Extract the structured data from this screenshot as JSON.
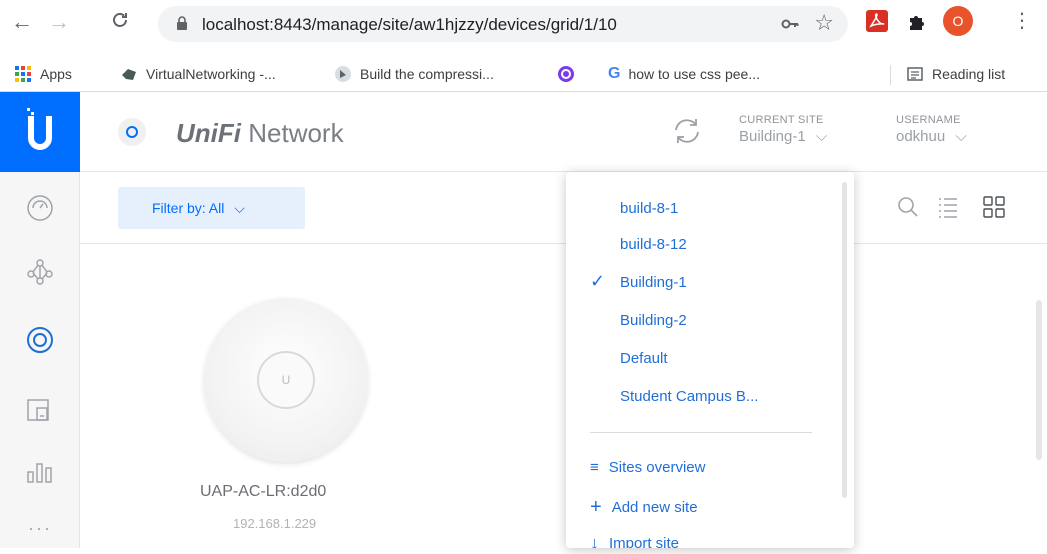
{
  "browser": {
    "url": "localhost:8443/manage/site/aw1hjzzy/devices/grid/1/10",
    "profile_initial": "O",
    "bookmarks": [
      {
        "label": "Apps",
        "icon": "apps-grid-icon"
      },
      {
        "label": "VirtualNetworking -...",
        "icon": "virtualnetworking-icon"
      },
      {
        "label": "Build the compressi...",
        "icon": "build-icon"
      },
      {
        "label": "",
        "icon": "coursera-icon"
      },
      {
        "label": "how to use css pee...",
        "icon": "google-icon"
      }
    ],
    "reading_list": "Reading list"
  },
  "app": {
    "title_brand": "UniFi",
    "title_product": "Network",
    "current_site_label": "CURRENT SITE",
    "current_site_value": "Building-1",
    "username_label": "USERNAME",
    "username_value": "odkhuu"
  },
  "toolbar": {
    "filter_label": "Filter by: All"
  },
  "device": {
    "model": "UAP-AC-LR:d2d0",
    "ip": "192.168.1.229",
    "logo_letter": "U"
  },
  "site_dropdown": {
    "sites": [
      {
        "name": "build-8-1",
        "selected": false
      },
      {
        "name": "build-8-12",
        "selected": false
      },
      {
        "name": "Building-1",
        "selected": true
      },
      {
        "name": "Building-2",
        "selected": false
      },
      {
        "name": "Default",
        "selected": false
      },
      {
        "name": "Student Campus B...",
        "selected": false
      }
    ],
    "actions": [
      {
        "label": "Sites overview",
        "icon": "list-icon"
      },
      {
        "label": "Add new site",
        "icon": "plus-icon"
      },
      {
        "label": "Import site",
        "icon": "import-icon"
      }
    ]
  },
  "colors": {
    "accent": "#006fff",
    "link": "#1f6fd6",
    "filter_bg": "#e6f0fd"
  }
}
